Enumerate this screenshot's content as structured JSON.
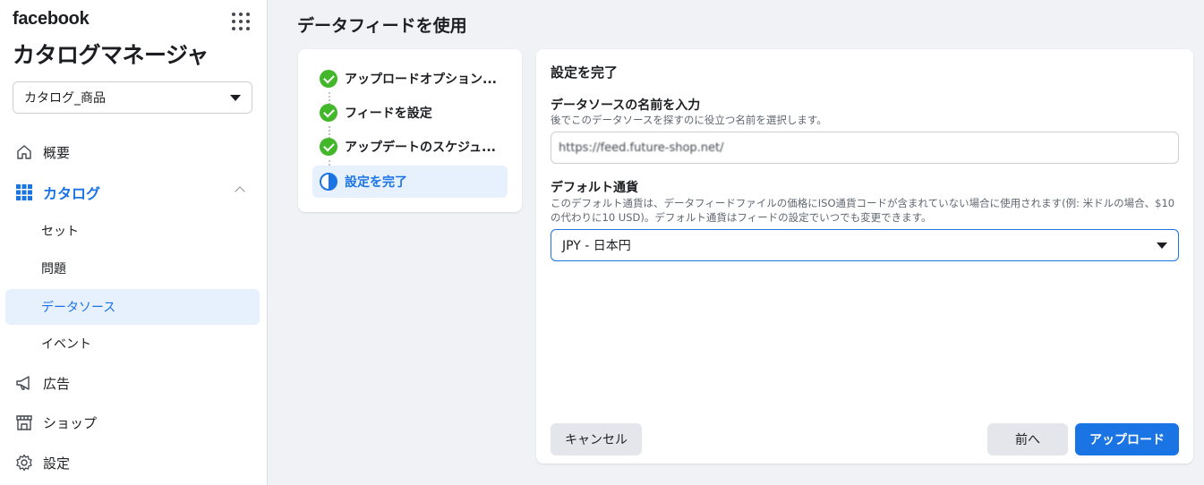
{
  "brand": {
    "logo_text": "facebook"
  },
  "app": {
    "title": "カタログマネージャ"
  },
  "catalog_selector": {
    "value": "カタログ_商品"
  },
  "sidebar": {
    "items": [
      {
        "label": "概要",
        "icon": "home-icon"
      },
      {
        "label": "カタログ",
        "icon": "grid-icon"
      },
      {
        "label": "セット"
      },
      {
        "label": "問題"
      },
      {
        "label": "データソース"
      },
      {
        "label": "イベント"
      },
      {
        "label": "広告",
        "icon": "megaphone-icon"
      },
      {
        "label": "ショップ",
        "icon": "shop-icon"
      },
      {
        "label": "設定",
        "icon": "gear-icon"
      }
    ]
  },
  "page": {
    "title": "データフィードを使用"
  },
  "steps": [
    {
      "label": "アップロードオプション...",
      "status": "done"
    },
    {
      "label": "フィードを設定",
      "status": "done"
    },
    {
      "label": "アップデートのスケジュ...",
      "status": "done"
    },
    {
      "label": "設定を完了",
      "status": "current"
    }
  ],
  "form": {
    "heading": "設定を完了",
    "source_name": {
      "label": "データソースの名前を入力",
      "help": "後でこのデータソースを探すのに役立つ名前を選択します。",
      "value": "https://feed.future-shop.net/"
    },
    "currency": {
      "label": "デフォルト通貨",
      "help": "このデフォルト通貨は、データフィードファイルの価格にISO通貨コードが含まれていない場合に使用されます(例: 米ドルの場合、$10の代わりに10 USD)。デフォルト通貨はフィードの設定でいつでも変更できます。",
      "value": "JPY - 日本円"
    },
    "buttons": {
      "cancel": "キャンセル",
      "back": "前へ",
      "upload": "アップロード"
    }
  },
  "colors": {
    "accent": "#1b74e4",
    "success": "#42b72a",
    "selected_bg": "#e7f0fd"
  }
}
